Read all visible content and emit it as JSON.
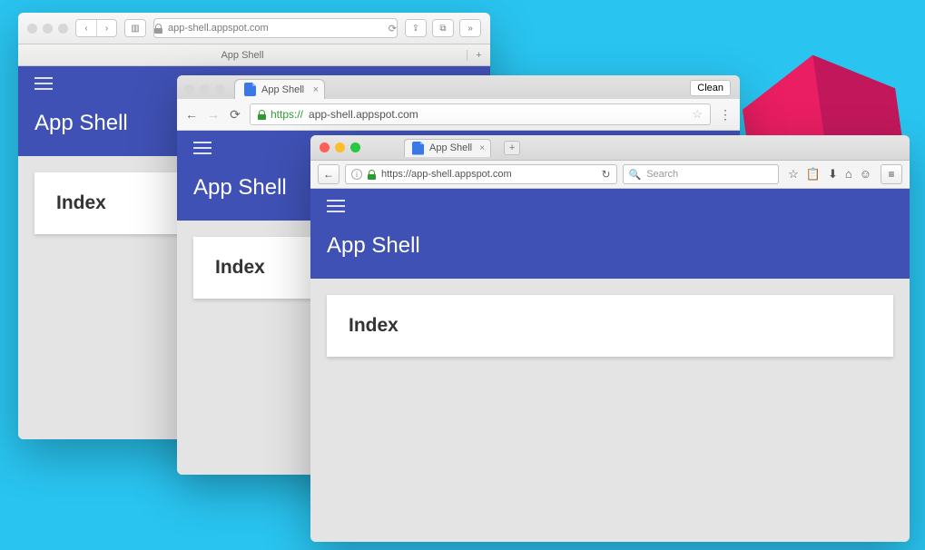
{
  "app": {
    "title": "App Shell",
    "card_heading": "Index"
  },
  "safari": {
    "address": "app-shell.appspot.com",
    "tab_title": "App Shell",
    "new_tab_label": "+"
  },
  "chrome": {
    "tab_title": "App Shell",
    "tab_close": "×",
    "url_scheme": "https://",
    "url_host": "app-shell.appspot.com",
    "clean_label": "Clean",
    "menu_glyph": "⋮"
  },
  "firefox": {
    "tab_title": "App Shell",
    "tab_close": "×",
    "new_tab_label": "+",
    "url": "https://app-shell.appspot.com",
    "info_glyph": "i",
    "reload_glyph": "↻",
    "search_placeholder": "Search",
    "icons": {
      "star": "☆",
      "clipboard": "📋",
      "download": "⬇",
      "home": "⌂",
      "chat": "☺"
    }
  }
}
